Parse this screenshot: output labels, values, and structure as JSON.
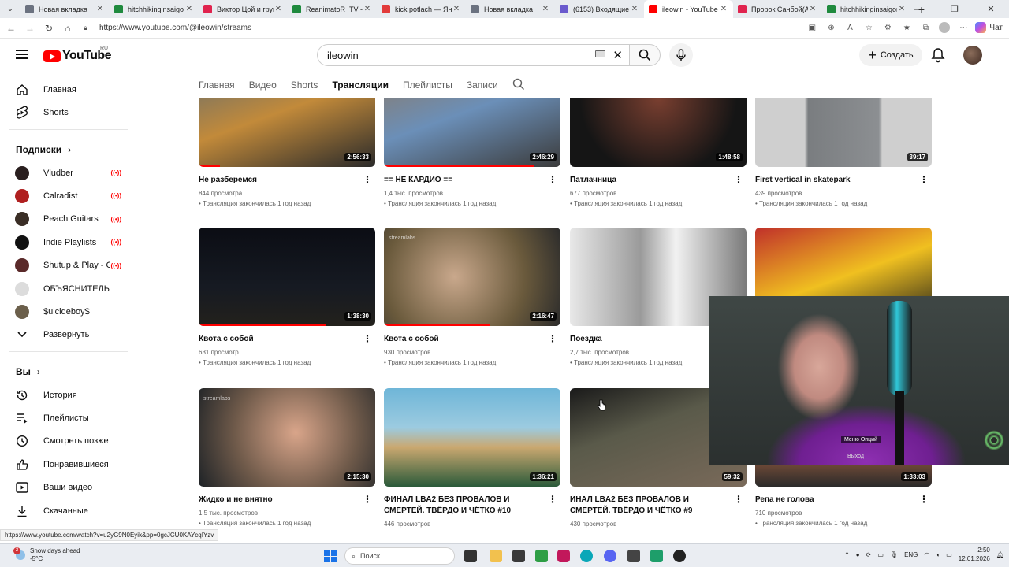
{
  "browser": {
    "tabs": [
      {
        "title": "Новая вкладка",
        "color": "#6b7280",
        "active": false
      },
      {
        "title": "hitchhikinginsaigon",
        "color": "#1f8a3e",
        "active": false
      },
      {
        "title": "Виктор Цой и груп",
        "color": "#e0234e",
        "active": false
      },
      {
        "title": "ReanimatoR_TV - W",
        "color": "#1f8a3e",
        "active": false
      },
      {
        "title": "kick potlach — Янд",
        "color": "#e23b3b",
        "active": false
      },
      {
        "title": "Новая вкладка",
        "color": "#6b7280",
        "active": false
      },
      {
        "title": "(6153) Входящие —",
        "color": "#6a5acd",
        "active": false
      },
      {
        "title": "ileowin - YouTube",
        "color": "#ff0000",
        "active": true
      },
      {
        "title": "Пророк Санбой(АР",
        "color": "#e0234e",
        "active": false
      },
      {
        "title": "hitchhikinginsaigon",
        "color": "#1f8a3e",
        "active": false
      }
    ],
    "url": "https://www.youtube.com/@ileowin/streams",
    "chat_label": "Чат",
    "status_url": "https://www.youtube.com/watch?v=u2yG9N0Eyik&pp=0gcJCU0KAYcqIYzv"
  },
  "header": {
    "logo_text": "YouTube",
    "region": "RU",
    "search_value": "ileowin",
    "create_label": "Создать"
  },
  "sidebar": {
    "main": [
      {
        "label": "Главная",
        "icon": "home-icon"
      },
      {
        "label": "Shorts",
        "icon": "shorts-icon"
      }
    ],
    "subs_heading": "Подписки",
    "subs": [
      {
        "label": "Vludber",
        "live": true,
        "color": "#2a1f1f"
      },
      {
        "label": "Calradist",
        "live": true,
        "color": "#b02020"
      },
      {
        "label": "Peach Guitars",
        "live": true,
        "color": "#3a2e26"
      },
      {
        "label": "Indie Playlists",
        "live": true,
        "color": "#111111"
      },
      {
        "label": "Shutup & Play - G...",
        "live": true,
        "color": "#5a2a2a"
      },
      {
        "label": "ОБЪЯСНИТЕЛЬНАЯ",
        "live": false,
        "color": "#dcdcdc"
      },
      {
        "label": "$uicideboy$",
        "live": false,
        "color": "#6b5f4b"
      }
    ],
    "expand_label": "Развернуть",
    "you_heading": "Вы",
    "you": [
      {
        "label": "История",
        "icon": "history-icon"
      },
      {
        "label": "Плейлисты",
        "icon": "playlists-icon"
      },
      {
        "label": "Смотреть позже",
        "icon": "watch-later-icon"
      },
      {
        "label": "Понравившиеся",
        "icon": "like-icon"
      },
      {
        "label": "Ваши видео",
        "icon": "your-videos-icon"
      },
      {
        "label": "Скачанные",
        "icon": "download-icon"
      }
    ]
  },
  "channel_tabs": [
    "Главная",
    "Видео",
    "Shorts",
    "Трансляции",
    "Плейлисты",
    "Записи"
  ],
  "active_tab": "Трансляции",
  "videos": [
    {
      "title": "Не разберемся",
      "views": "844 просмотра",
      "when": "• Трансляция закончилась 1 год назад",
      "duration": "2:56:33",
      "progress": 0.12,
      "bg": "linear-gradient(160deg,#6b6f6a 0%,#c28a3a 45%,#2a2a2a 100%)",
      "watermark": ""
    },
    {
      "title": "== НЕ КАРДИО ==",
      "views": "1,4 тыс. просмотров",
      "when": "• Трансляция закончилась 1 год назад",
      "duration": "2:46:29",
      "progress": 0.85,
      "bg": "linear-gradient(160deg,#8a7a6a 0%,#6b8fb8 45%,#3b3b3b 100%)",
      "watermark": ""
    },
    {
      "title": "Патлачница",
      "views": "677 просмотров",
      "when": "• Трансляция закончилась 1 год назад",
      "duration": "1:48:58",
      "progress": 0.0,
      "bg": "radial-gradient(circle at 50% 30%,#7a3f30,#151515 70%)",
      "watermark": ""
    },
    {
      "title": "First vertical in skatepark",
      "views": "439 просмотров",
      "when": "• Трансляция закончилась 1 год назад",
      "duration": "39:17",
      "progress": 0.0,
      "bg": "linear-gradient(90deg,#cfcfcf 0%,#cfcfcf 28%,#7a7d80 30%,#8c8f92 70%,#cfcfcf 72%)",
      "watermark": ""
    },
    {
      "title": "Квота с собой",
      "views": "631 просмотр",
      "when": "• Трансляция закончилась 1 год назад",
      "duration": "1:38:30",
      "progress": 0.72,
      "bg": "linear-gradient(180deg,#0b0d14 0%,#161a22 60%,#23211c 100%)",
      "watermark": ""
    },
    {
      "title": "Квота с собой",
      "views": "930 просмотров",
      "when": "• Трансляция закончилась 1 год назад",
      "duration": "2:16:47",
      "progress": 0.6,
      "bg": "radial-gradient(circle at 40% 50%,#c9a88c,#6a5a3c 60%,#2b2b2b)",
      "watermark": "streamlabs"
    },
    {
      "title": "Поездка",
      "views": "2,7 тыс. просмотров",
      "when": "• Трансляция закончилась 1 год назад",
      "duration": "",
      "progress": 0.0,
      "bg": "linear-gradient(90deg,#e8e8e8,#9a9a9a 40%,#f2f2f2 60%,#7a7a7a)",
      "watermark": ""
    },
    {
      "title": "",
      "views": "",
      "when": "",
      "duration": "",
      "progress": 0.0,
      "bg": "linear-gradient(160deg,#c0302a 0%,#f0c020 50%,#1a1a1a 100%)",
      "watermark": ""
    },
    {
      "title": "Жидко и не внятно",
      "views": "1,5 тыс. просмотров",
      "when": "• Трансляция закончилась 1 год назад",
      "duration": "2:15:30",
      "progress": 0.0,
      "bg": "radial-gradient(circle at 55% 45%,#d9a58a,#6f5a4a 55%,#1d2226)",
      "watermark": "streamlabs"
    },
    {
      "title": "ФИНАЛ LBA2 БЕЗ ПРОВАЛОВ И СМЕРТЕЙ. ТВЁРДО И ЧЁТКО #10",
      "views": "446 просмотров",
      "when": "• Трансляция закончилась 1 год назад",
      "duration": "1:36:21",
      "progress": 0.0,
      "bg": "linear-gradient(180deg,#6fb6d8 0%,#9ccbe0 40%,#caa870 60%,#2a5a3a 100%)",
      "watermark": ""
    },
    {
      "title": "ИНАЛ LBA2 БЕЗ ПРОВАЛОВ И СМЕРТЕЙ. ТВЁРДО И ЧЁТКО #9",
      "views": "430 просмотров",
      "when": "• Трансляция закончилась 1 год назад",
      "duration": "59:32",
      "progress": 0.0,
      "bg": "linear-gradient(160deg,#1a1a1a 0%,#5a5a4a 40%,#7a6a5a 100%)",
      "watermark": ""
    },
    {
      "title": "Репа не голова",
      "views": "710 просмотров",
      "when": "• Трансляция закончилась 1 год назад",
      "duration": "1:33:03",
      "progress": 0.0,
      "bg": "linear-gradient(180deg,#5a3a2a 0%,#a06040 60%,#2a2a2a 100%)",
      "watermark": ""
    }
  ],
  "webcam": {
    "caption": "Меню Опций",
    "caption2": "Выход"
  },
  "taskbar": {
    "weather_title": "Snow days ahead",
    "weather_temp": "-5°C",
    "weather_badge": "2",
    "search_placeholder": "Поиск",
    "lang": "ENG",
    "time": "2:50",
    "date": "12.01.2026"
  }
}
